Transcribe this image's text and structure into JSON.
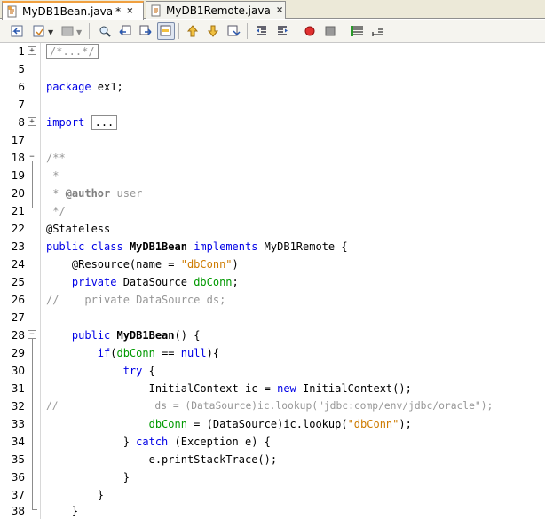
{
  "tabs": [
    {
      "label": "MyDB1Bean.java",
      "modified": "*",
      "close": "×",
      "active": true
    },
    {
      "label": "MyDB1Remote.java",
      "close": "×",
      "active": false
    }
  ],
  "toolbar": {
    "icons": [
      "back-to-source-icon",
      "history-icon",
      "dropdown-history-icon",
      "find-icon",
      "find-previous-icon",
      "find-next-icon",
      "toggle-highlight-icon",
      "prev-bookmark-icon",
      "next-bookmark-icon",
      "toggle-bookmark-icon",
      "shift-left-icon",
      "shift-right-icon",
      "record-macro-icon",
      "stop-macro-icon",
      "comment-icon",
      "uncomment-icon"
    ]
  },
  "lines": [
    {
      "n": "1",
      "text": "/*...*/"
    },
    {
      "n": "5",
      "text": ""
    },
    {
      "n": "6",
      "text": "package ex1;"
    },
    {
      "n": "7",
      "text": ""
    },
    {
      "n": "8",
      "text": "import ..."
    },
    {
      "n": "17",
      "text": ""
    },
    {
      "n": "18",
      "text": "/**"
    },
    {
      "n": "19",
      "text": " *"
    },
    {
      "n": "20",
      "text": " * @author user"
    },
    {
      "n": "21",
      "text": " */"
    },
    {
      "n": "22",
      "text": "@Stateless"
    },
    {
      "n": "23",
      "text": "public class MyDB1Bean implements MyDB1Remote {"
    },
    {
      "n": "24",
      "text": "    @Resource(name = \"dbConn\")"
    },
    {
      "n": "25",
      "text": "    private DataSource dbConn;"
    },
    {
      "n": "26",
      "text": "//    private DataSource ds;"
    },
    {
      "n": "27",
      "text": ""
    },
    {
      "n": "28",
      "text": "    public MyDB1Bean() {"
    },
    {
      "n": "29",
      "text": "        if(dbConn == null){"
    },
    {
      "n": "30",
      "text": "            try {"
    },
    {
      "n": "31",
      "text": "                InitialContext ic = new InitialContext();"
    },
    {
      "n": "32",
      "text": "//                ds = (DataSource)ic.lookup(\"jdbc:comp/env/jdbc/oracle\");"
    },
    {
      "n": "33",
      "text": "                dbConn = (DataSource)ic.lookup(\"dbConn\");"
    },
    {
      "n": "34",
      "text": "            } catch (Exception e) {"
    },
    {
      "n": "35",
      "text": "                e.printStackTrace();"
    },
    {
      "n": "36",
      "text": "            }"
    },
    {
      "n": "37",
      "text": "        }"
    },
    {
      "n": "38",
      "text": "    }"
    }
  ],
  "tokens": {
    "l1": "/*...*/",
    "l6_kw": "package",
    "l6_rest": " ex1;",
    "l8_kw": "import",
    "l8_box": "...",
    "l18": "/**",
    "l19": " *",
    "l20_a": " * ",
    "l20_tag": "@author",
    "l20_b": " user",
    "l21": " */",
    "l22": "@Stateless",
    "l23_kw1": "public class",
    "l23_name": "MyDB1Bean",
    "l23_kw2": "implements",
    "l23_rest": " MyDB1Remote {",
    "l24_a": "    @Resource(name = ",
    "l24_str": "\"dbConn\"",
    "l24_b": ")",
    "l25_kw": "    private",
    "l25_a": " DataSource ",
    "l25_fld": "dbConn",
    "l25_b": ";",
    "l26": "//    private DataSource ds;",
    "l28_kw": "    public",
    "l28_name": "MyDB1Bean",
    "l28_b": "() {",
    "l29_kw": "        if",
    "l29_a": "(",
    "l29_fld": "dbConn",
    "l29_b": " == ",
    "l29_kw2": "null",
    "l29_c": "){",
    "l30_kw": "            try",
    "l30_b": " {",
    "l31_a": "                InitialContext ic = ",
    "l31_kw": "new",
    "l31_b": " InitialContext();",
    "l32_c": "//",
    "l32_code": "                ds = (DataSource)ic.lookup(\"jdbc:comp/env/jdbc/oracle\");",
    "l33_a": "                ",
    "l33_fld": "dbConn",
    "l33_b": " = (DataSource)ic.lookup(",
    "l33_str": "\"dbConn\"",
    "l33_c": ");",
    "l34_a": "            } ",
    "l34_kw": "catch",
    "l34_b": " (Exception e) {",
    "l35": "                e.printStackTrace();",
    "l36": "            }",
    "l37": "        }",
    "l38": "    }"
  }
}
